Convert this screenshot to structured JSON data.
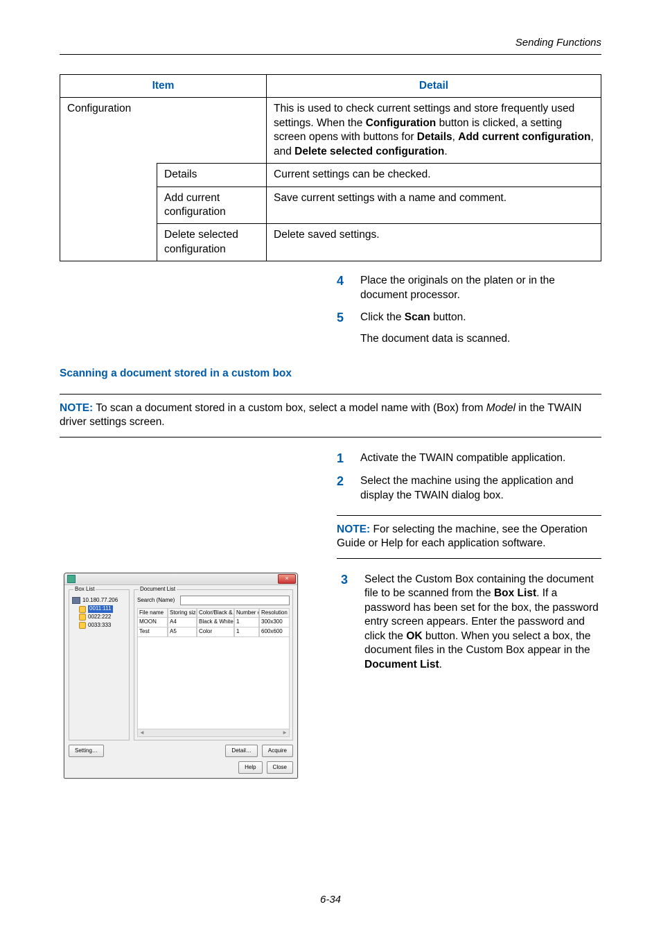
{
  "running_head": "Sending Functions",
  "table": {
    "headers": {
      "item": "Item",
      "detail": "Detail"
    },
    "rows": {
      "config": {
        "label": "Configuration",
        "detail_pre": "This is used to check current settings and store frequently used settings. When the ",
        "detail_b1": "Configuration",
        "detail_mid1": " button is clicked, a setting screen opens with buttons for ",
        "detail_b2": "Details",
        "detail_mid2": ", ",
        "detail_b3": "Add current configuration",
        "detail_mid3": ", and ",
        "detail_b4": "Delete selected configuration",
        "detail_end": "."
      },
      "details": {
        "label": "Details",
        "detail": "Current settings can be checked."
      },
      "addcur": {
        "label": "Add current configuration",
        "detail": "Save current settings with a name and comment."
      },
      "delsel": {
        "label": "Delete selected configuration",
        "detail": "Delete saved settings."
      }
    }
  },
  "steps_a": {
    "n4": "4",
    "t4": "Place the originals on the platen or in the document processor.",
    "n5": "5",
    "t5_pre": "Click the ",
    "t5_b": "Scan",
    "t5_post": " button.",
    "t5_p2": "The document data is scanned."
  },
  "subsection": "Scanning a document stored in a custom box",
  "note1": {
    "label": "NOTE:",
    "body_pre": " To scan a document stored in a custom box, select a model name with (Box) from ",
    "body_i": "Model",
    "body_post": " in the TWAIN driver settings screen."
  },
  "steps_b": {
    "n1": "1",
    "t1": "Activate the TWAIN compatible application.",
    "n2": "2",
    "t2": "Select the machine using the application and display the TWAIN dialog box."
  },
  "note2": {
    "label": "NOTE:",
    "body": " For selecting the machine, see the Operation Guide or Help for each application software."
  },
  "steps_c": {
    "n3": "3",
    "t3_pre": "Select the Custom Box containing the document file to be scanned from the ",
    "t3_b1": "Box List",
    "t3_mid1": ". If a password has been set for the box, the password entry screen appears. Enter the password and click the ",
    "t3_b2": "OK",
    "t3_mid2": " button. When you select a box, the document files in the Custom Box appear in the ",
    "t3_b3": "Document List",
    "t3_end": "."
  },
  "dialog": {
    "title_faded": "",
    "close_x": "×",
    "boxlist_legend": "Box List",
    "root_ip": "10.180.77.206",
    "items": {
      "i1": "0011:111",
      "i2": "0022:222",
      "i3": "0033:333"
    },
    "doclist_legend": "Document List",
    "search_label": "Search (Name)",
    "cols": {
      "fn": "File name",
      "ss": "Storing size",
      "cb": "Color/Black &…",
      "np": "Number of…",
      "rs": "Resolution"
    },
    "row1": {
      "fn": "MOON",
      "ss": "A4",
      "cb": "Black & White",
      "np": "1",
      "rs": "300x300"
    },
    "row2": {
      "fn": "Test",
      "ss": "A5",
      "cb": "Color",
      "np": "1",
      "rs": "600x600"
    },
    "btn_setting": "Setting…",
    "btn_detail": "Detail…",
    "btn_acquire": "Acquire",
    "btn_help": "Help",
    "btn_close": "Close"
  },
  "page_number": "6-34"
}
